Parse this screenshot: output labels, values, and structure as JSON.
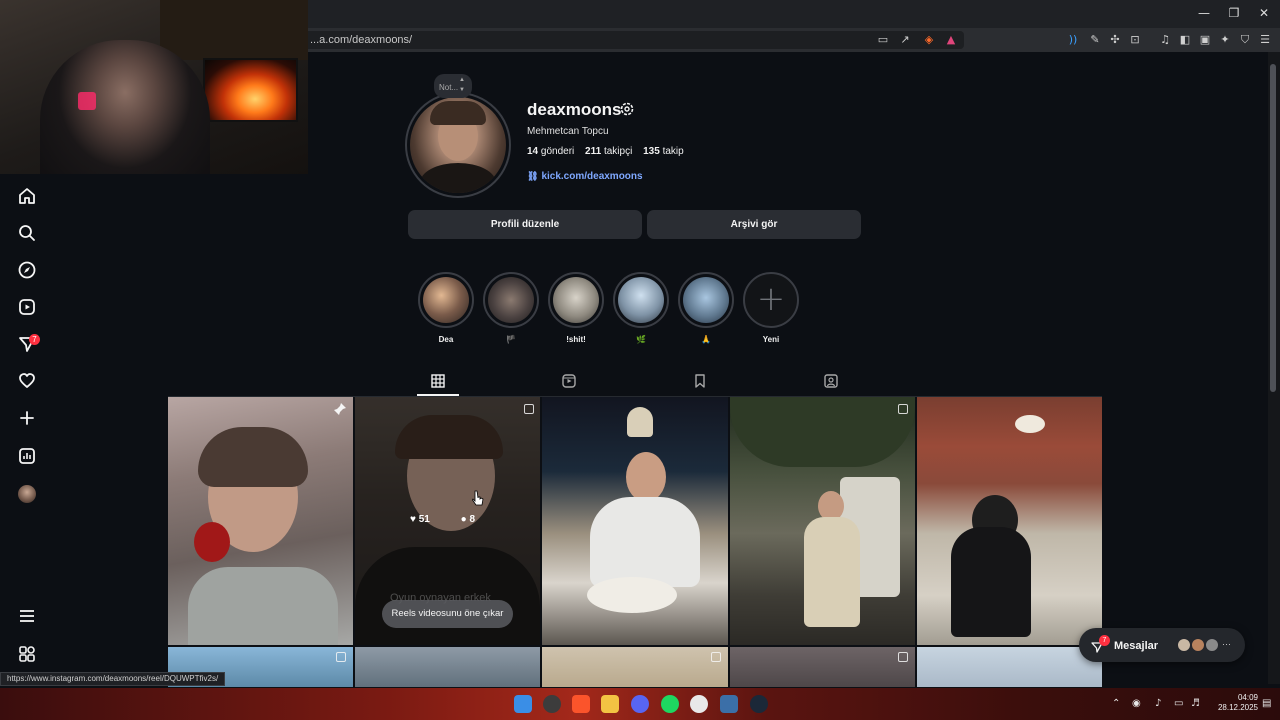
{
  "browser": {
    "url": "...a.com/deaxmoons/",
    "status_url": "https://www.instagram.com/deaxmoons/reel/DQUWPTfiv2s/"
  },
  "profile": {
    "note": "Not...",
    "username": "deaxmoons",
    "full_name": "Mehmetcan Topcu",
    "stats": [
      {
        "count": "14",
        "label": "gönderi"
      },
      {
        "count": "211",
        "label": "takipçi"
      },
      {
        "count": "135",
        "label": "takip"
      }
    ],
    "link": "kick.com/deaxmoons",
    "edit_button": "Profili düzenle",
    "archive_button": "Arşivi gör"
  },
  "highlights": [
    {
      "label": "Dea"
    },
    {
      "label": "🏴"
    },
    {
      "label": "!shit!"
    },
    {
      "label": "🌿"
    },
    {
      "label": "🙏"
    },
    {
      "label": "Yeni"
    }
  ],
  "nav": {
    "notifications_badge": "7"
  },
  "grid": {
    "hover_likes": "51",
    "hover_comments": "8",
    "faded_caption": "Oyun oynayan erkek",
    "reels_pill": "Reels videosunu öne çıkar"
  },
  "messages": {
    "label": "Mesajlar",
    "badge": "7"
  },
  "taskbar": {
    "time": "04:09",
    "date": "28.12.2025"
  },
  "colors": {
    "background": "#0c0f14",
    "accent_link": "#7fa8ff",
    "badge": "#ff3040",
    "button": "#2a2d33"
  }
}
